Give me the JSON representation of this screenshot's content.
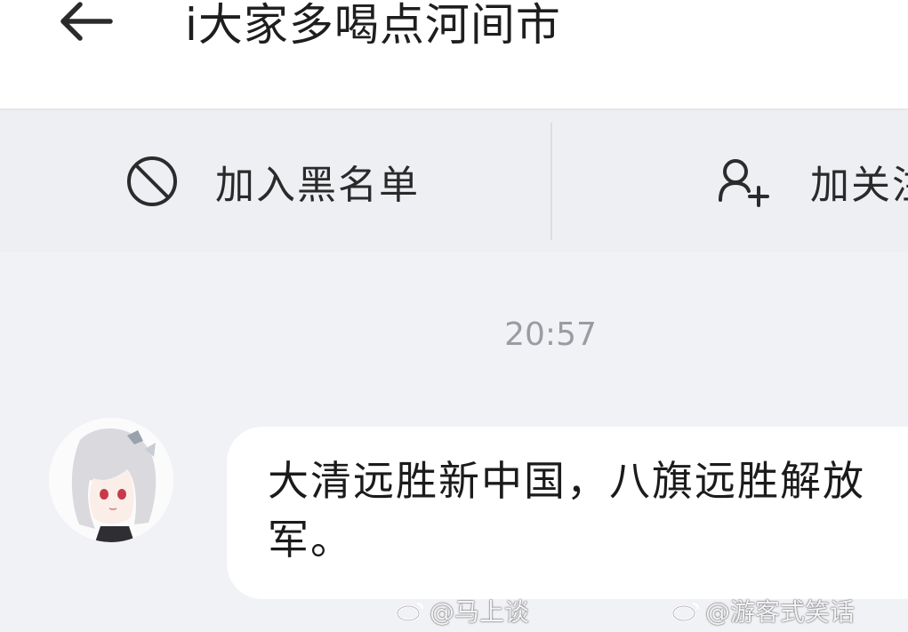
{
  "header": {
    "back_icon": "arrow-left-icon",
    "title": "i大家多喝点河间市"
  },
  "actions": {
    "block_icon": "block-circle-icon",
    "block_label": "加入黑名单",
    "follow_icon": "add-person-icon",
    "follow_label": "加关注"
  },
  "chat": {
    "timestamp": "20:57",
    "messages": [
      {
        "avatar_icon": "anime-avatar",
        "text": "大清远胜新中国，八旗远胜解放军。"
      }
    ]
  },
  "watermarks": {
    "left": "@马上谈",
    "right": "@游客式笑话"
  },
  "colors": {
    "background": "#f1f2f6",
    "header_bg": "#ffffff",
    "bubble_bg": "#ffffff",
    "text": "#1b1b1b",
    "timestamp": "#9a9ca2"
  }
}
